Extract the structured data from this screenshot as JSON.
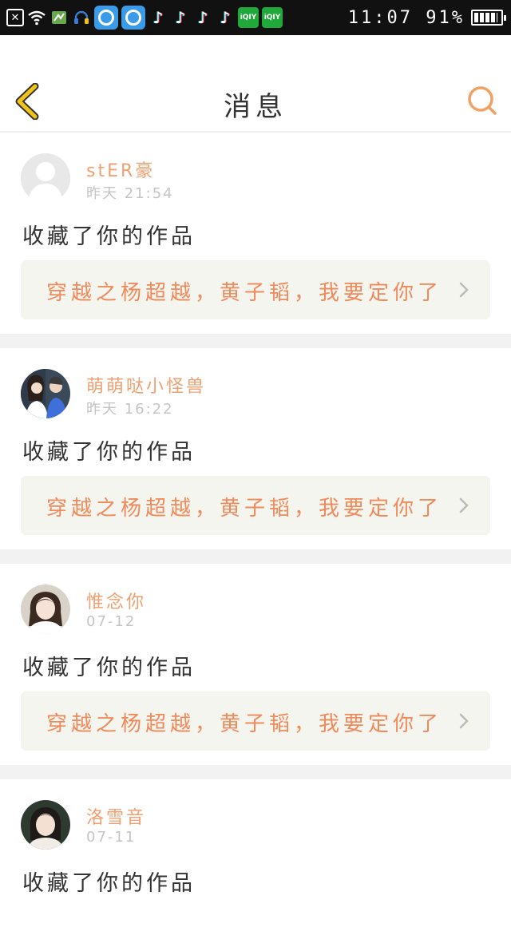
{
  "status_bar": {
    "time_battery": "11:07 91%",
    "notification_icons": [
      "close-box-icon",
      "wifi-icon",
      "app-icon",
      "headset-icon",
      "blue-circle-app-icon",
      "blue-circle-app-icon",
      "tiktok-icon",
      "tiktok-icon",
      "tiktok-icon",
      "tiktok-icon",
      "iqiyi-icon",
      "iqiyi-icon"
    ],
    "iqiyi_label": "iQIY",
    "battery_level": 0.91
  },
  "header": {
    "title": "消息"
  },
  "colors": {
    "accent": "#f08a5a",
    "username": "#f0a070",
    "back_arrow": "#f0c419",
    "search_icon": "#f3a064",
    "work_link_bg": "#f5f5f0",
    "separator": "#f2f2f2"
  },
  "messages": [
    {
      "username": "stER豪",
      "time": "昨天 21:54",
      "action": "收藏了你的作品",
      "work_title": "穿越之杨超越，黄子韬，我要定你了",
      "avatar": "default-avatar-icon"
    },
    {
      "username": "萌萌哒小怪兽",
      "time": "昨天 16:22",
      "action": "收藏了你的作品",
      "work_title": "穿越之杨超越，黄子韬，我要定你了",
      "avatar": "user-photo-avatar"
    },
    {
      "username": "惟念你",
      "time": "07-12",
      "action": "收藏了你的作品",
      "work_title": "穿越之杨超越，黄子韬，我要定你了",
      "avatar": "user-photo-avatar"
    },
    {
      "username": "洛雪音",
      "time": "07-11",
      "action": "收藏了你的作品",
      "avatar": "user-photo-avatar"
    }
  ]
}
